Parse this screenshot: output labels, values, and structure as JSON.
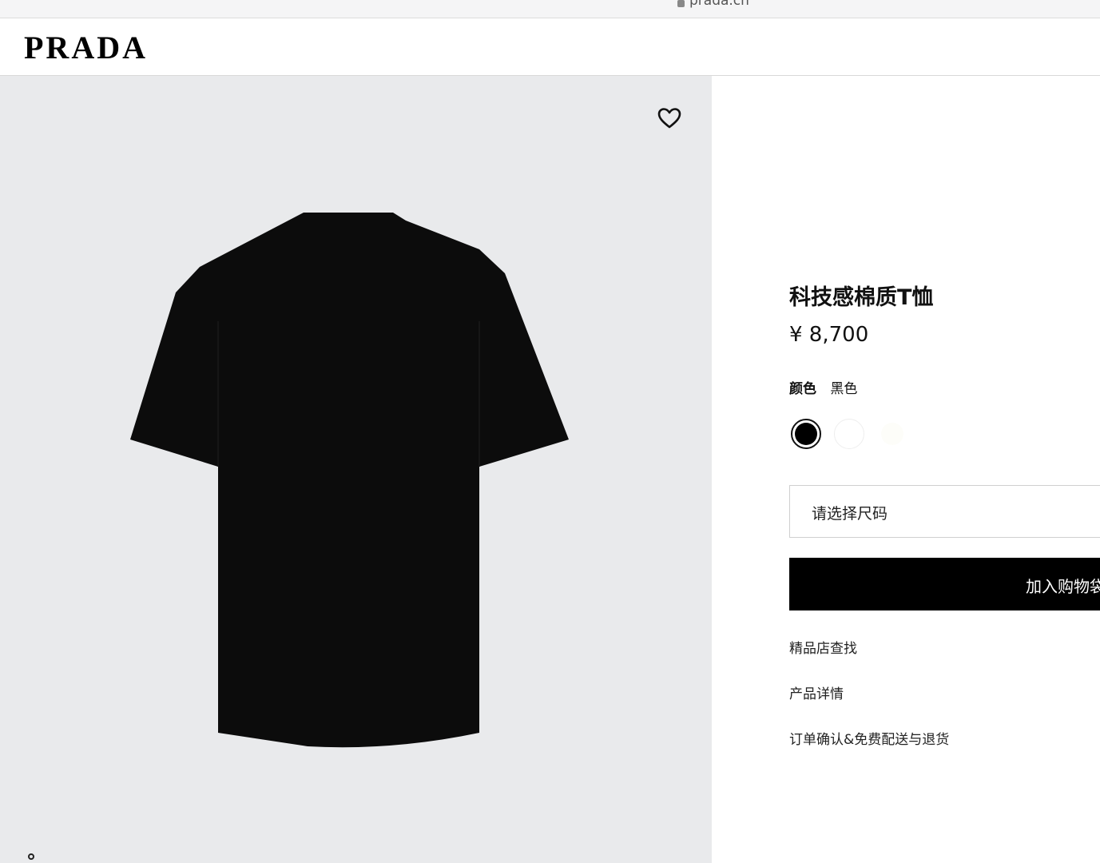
{
  "browser": {
    "url": "prada.cn"
  },
  "header": {
    "logo": "PRADA"
  },
  "gallery": {
    "wishlist_icon": "heart-outline-icon",
    "product_image": "black-tshirt-back-view"
  },
  "product": {
    "title": "科技感棉质T恤",
    "price": "¥ 8,700",
    "color_label": "颜色",
    "color_value": "黑色",
    "swatches": [
      {
        "name": "black",
        "color": "#000000",
        "selected": true
      },
      {
        "name": "white",
        "color": "#ffffff",
        "selected": false
      },
      {
        "name": "beige",
        "color": "#fdfdf9",
        "selected": false
      }
    ],
    "size_placeholder": "请选择尺码",
    "add_to_bag": "加入购物袋",
    "links": [
      "精品店查找",
      "产品详情",
      "订单确认&免费配送与退货"
    ]
  }
}
